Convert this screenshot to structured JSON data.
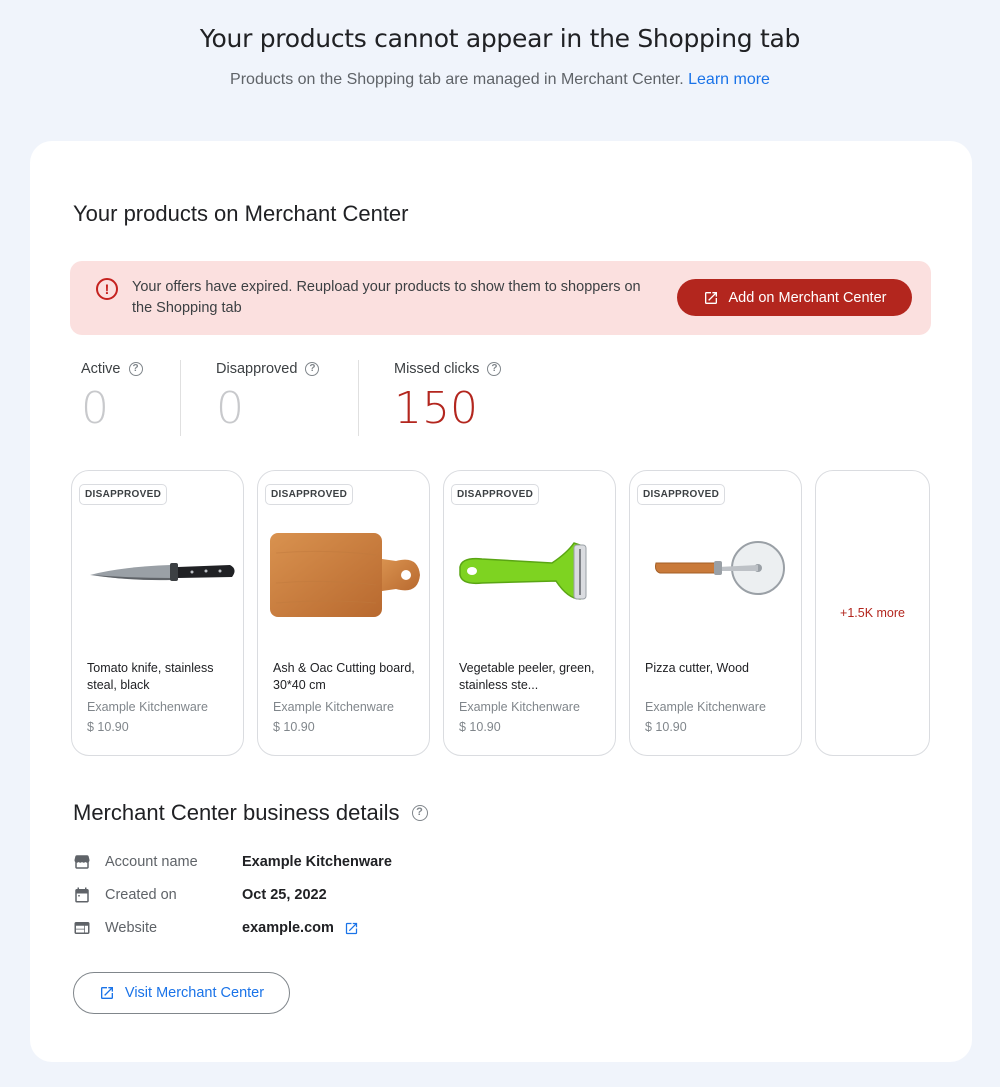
{
  "header": {
    "title": "Your products cannot appear in the Shopping tab",
    "subtitle": "Products on the Shopping tab are managed in Merchant Center.",
    "learn_more": "Learn more"
  },
  "card": {
    "title": "Your products on Merchant Center",
    "alert": {
      "message": "Your offers have expired. Reupload your products to show them to shoppers on the Shopping tab",
      "button": "Add on Merchant Center",
      "color": "#b3261e"
    },
    "stats": [
      {
        "label": "Active",
        "value": "0"
      },
      {
        "label": "Disapproved",
        "value": "0"
      },
      {
        "label": "Missed clicks",
        "value": "150"
      }
    ],
    "products": [
      {
        "badge": "DISAPPROVED",
        "name": "Tomato knife, stainless steal, black",
        "store": "Example Kitchenware",
        "price": "$ 10.90",
        "image": "knife"
      },
      {
        "badge": "DISAPPROVED",
        "name": "Ash & Oac Cutting board, 30*40 cm",
        "store": "Example Kitchenware",
        "price": "$ 10.90",
        "image": "cutting-board"
      },
      {
        "badge": "DISAPPROVED",
        "name": "Vegetable peeler, green, stainless ste...",
        "store": "Example Kitchenware",
        "price": "$ 10.90",
        "image": "peeler"
      },
      {
        "badge": "DISAPPROVED",
        "name": "Pizza cutter, Wood",
        "store": "Example Kitchenware",
        "price": "$ 10.90",
        "image": "pizza-cutter"
      }
    ],
    "more": "+1.5K more"
  },
  "details": {
    "title": "Merchant Center business details",
    "rows": [
      {
        "label": "Account name",
        "value": "Example Kitchenware",
        "icon": "store-icon"
      },
      {
        "label": "Created on",
        "value": "Oct 25, 2022",
        "icon": "calendar-icon"
      },
      {
        "label": "Website",
        "value": "example.com",
        "icon": "web-icon"
      }
    ],
    "visit_button": "Visit Merchant Center"
  },
  "colors": {
    "accent": "#1a73e8",
    "error": "#b3261e",
    "background": "#f0f4fb"
  }
}
